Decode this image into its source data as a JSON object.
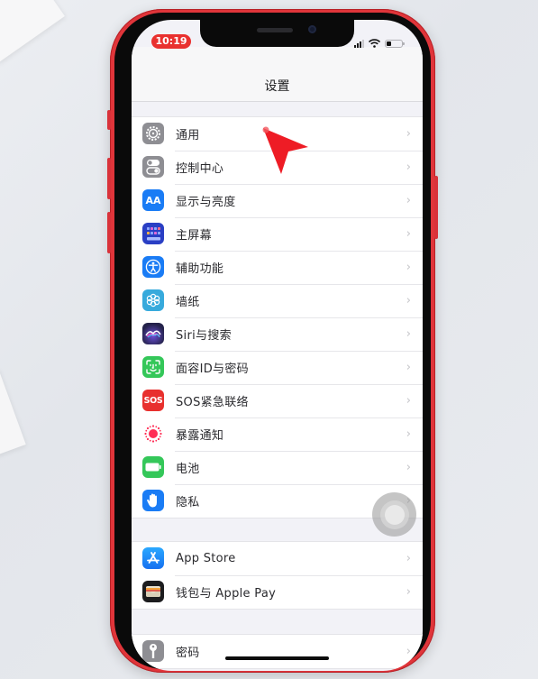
{
  "status_bar": {
    "time": "10:19",
    "signal_icon": "cellular-signal-icon",
    "wifi_icon": "wifi-icon",
    "battery_icon": "battery-low-icon",
    "battery_level": 0.3,
    "time_pill_color": "#e9312f"
  },
  "navbar": {
    "title": "设置"
  },
  "groups": [
    {
      "items": [
        {
          "label": "通用",
          "icon": "gear-icon",
          "color": "#8e8e93"
        },
        {
          "label": "控制中心",
          "icon": "toggles-icon",
          "color": "#8e8e93"
        },
        {
          "label": "显示与亮度",
          "icon": "text-size-icon",
          "color": "#1a7cf5"
        },
        {
          "label": "主屏幕",
          "icon": "home-screen-grid-icon",
          "color": "#2a3fc4"
        },
        {
          "label": "辅助功能",
          "icon": "accessibility-icon",
          "color": "#1a7cf5"
        },
        {
          "label": "墙纸",
          "icon": "flower-icon",
          "color": "#37aadc"
        },
        {
          "label": "Siri与搜索",
          "icon": "siri-icon",
          "color": "#24224a"
        },
        {
          "label": "面容ID与密码",
          "icon": "face-id-icon",
          "color": "#34c759"
        },
        {
          "label": "SOS紧急联络",
          "icon": "sos-icon",
          "color": "#e8302e"
        },
        {
          "label": "暴露通知",
          "icon": "exposure-notification-icon",
          "color": "#ffffff"
        },
        {
          "label": "电池",
          "icon": "battery-icon",
          "color": "#34c759"
        },
        {
          "label": "隐私",
          "icon": "hand-icon",
          "color": "#1a7cf5"
        }
      ]
    },
    {
      "items": [
        {
          "label": "App Store",
          "icon": "app-store-icon",
          "color": "#1d8df5"
        },
        {
          "label": "钱包与 Apple Pay",
          "icon": "wallet-icon",
          "color": "#1c1c1e"
        }
      ]
    },
    {
      "items": [
        {
          "label": "密码",
          "icon": "key-icon",
          "color": "#8e8e93"
        }
      ]
    }
  ],
  "chevron": "›",
  "overlays": {
    "cursor_icon": "red-pointer-cursor-icon",
    "assistive_touch": "assistive-touch-button"
  }
}
